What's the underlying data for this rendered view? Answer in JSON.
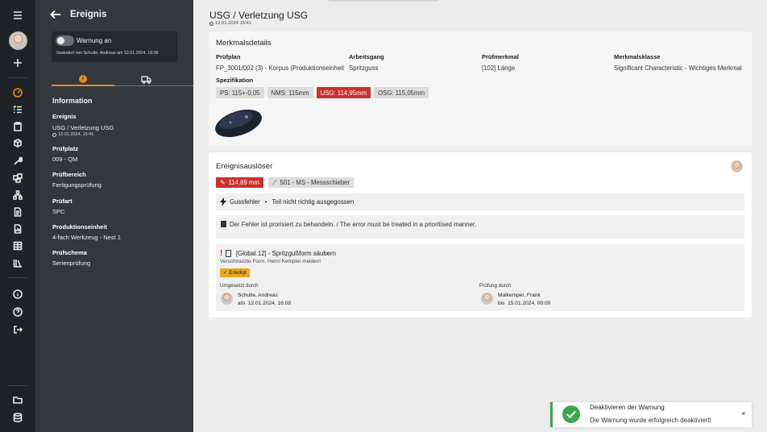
{
  "panel": {
    "title": "Ereignis",
    "warning_toggle_label": "Warnung an",
    "warning_meta": "Geändert von Schulte, Andreas am 12.01.2024, 16:36",
    "section_heading": "Information",
    "fields": [
      {
        "key": "Ereignis",
        "value": "USG / Verletzung USG",
        "timestamp": "12.01.2024, 15:41"
      },
      {
        "key": "Prüfplatz",
        "value": "009 - QM"
      },
      {
        "key": "Prüfbereich",
        "value": "Fertigungsprüfung"
      },
      {
        "key": "Prüfart",
        "value": "SPC"
      },
      {
        "key": "Produktionseinheit",
        "value": "4-fach Werkzeug - Nest 1"
      },
      {
        "key": "Prüfschema",
        "value": "Serienprüfung"
      }
    ]
  },
  "main": {
    "title": "USG / Verletzung USG",
    "timestamp": "12.01.2024 15:41"
  },
  "merkmal": {
    "heading": "Merkmalsdetails",
    "columns": [
      {
        "key": "Prüfplan",
        "value": "FP_3001/002 (3) - Korpus (Produktionseinheit"
      },
      {
        "key": "Arbeitsgang",
        "value": "Spritzguss"
      },
      {
        "key": "Prüfmerkmal",
        "value": "[102] Länge"
      },
      {
        "key": "Merkmalsklasse",
        "value": "Significant Characteristic - Wichtiges Merkmal"
      }
    ],
    "spec_label": "Spezifikation",
    "spec_chips": [
      "PS: 115+-0,05",
      "NMS: 115mm",
      "USG: 114,95mm",
      "OSG: 115,05mm"
    ]
  },
  "trigger": {
    "heading": "Ereignisauslöser",
    "measured_value": "114,89 mm",
    "gauge": "501 - MS - Messschieber",
    "defect_type": "Gussfehler",
    "defect_desc": "Teil nicht richtig ausgegossen",
    "note": "Der Fehler ist prorisiert zu behandeln. / The error must be treated in a prioritised manner.",
    "task": {
      "title": "[Global.12] - Spritzgußform säubern",
      "description": "Verschmutzte Form. Herrn Kempler melden!",
      "status": "Erledigt",
      "done_by_label": "Umgesetzt durch",
      "done_by_name": "Schulte, Andreas",
      "done_by_date_prefix": "am",
      "done_by_date": "12.01.2024, 16:08",
      "check_by_label": "Prüfung durch",
      "check_by_name": "Malkemper, Frank",
      "check_by_date_prefix": "bis",
      "check_by_date": "15.01.2024, 00:00"
    }
  },
  "toast": {
    "heading": "Deaktivieren der Warnung",
    "message": "Die Warnung wurde erfolgreich deaktiviert!",
    "close": "×"
  },
  "colors": {
    "accent": "#e8891b",
    "danger": "#c8312e",
    "success": "#3aa84a",
    "warning_badge": "#e8a81f"
  },
  "icons": [
    "menu-icon",
    "plus-icon",
    "dashboard-icon",
    "checklist-icon",
    "clipboard-icon",
    "cubes-icon",
    "wrench-icon",
    "puzzle-icon",
    "sitemap-icon",
    "document-icon",
    "file-chart-icon",
    "table-icon",
    "library-icon",
    "info-icon",
    "help-icon",
    "logout-icon",
    "folder-icon",
    "database-icon"
  ]
}
